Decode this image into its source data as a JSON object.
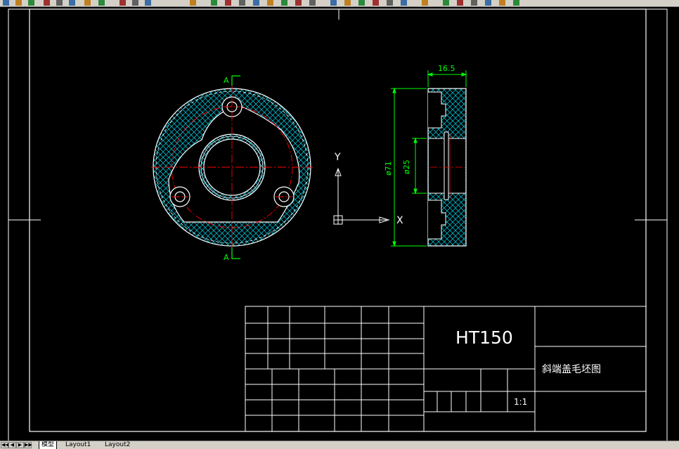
{
  "toolbar": {
    "icons": [
      "open-icon",
      "save-icon",
      "print-icon",
      "cut-icon",
      "copy-icon",
      "paste-icon",
      "undo-icon",
      "pan-icon",
      "zoom-icon",
      "zoom-window-icon",
      "zoom-previous-icon",
      "properties-icon",
      "design-center-icon",
      "tool-palettes-icon",
      "help-icon"
    ]
  },
  "drawing": {
    "view_label_top": "A",
    "view_label_bottom": "A",
    "dim_width": "16.5",
    "dim_outer": "ø71",
    "dim_inner": "ø25",
    "ucs_y": "Y",
    "ucs_x": "X",
    "colors": {
      "outline": "#ffffff",
      "hatch": "#00b4c8",
      "centerline": "#ff0000",
      "dimension": "#00ff00",
      "title_block": "#ffffff"
    }
  },
  "title_block": {
    "material": "HT150",
    "part_name": "斜端盖毛坯图",
    "scale": "1:1"
  },
  "tabs": {
    "nav": [
      "◀◀",
      "◀",
      "▶",
      "▶▶"
    ],
    "model": "模型",
    "layout1": "Layout1",
    "layout2": "Layout2"
  }
}
